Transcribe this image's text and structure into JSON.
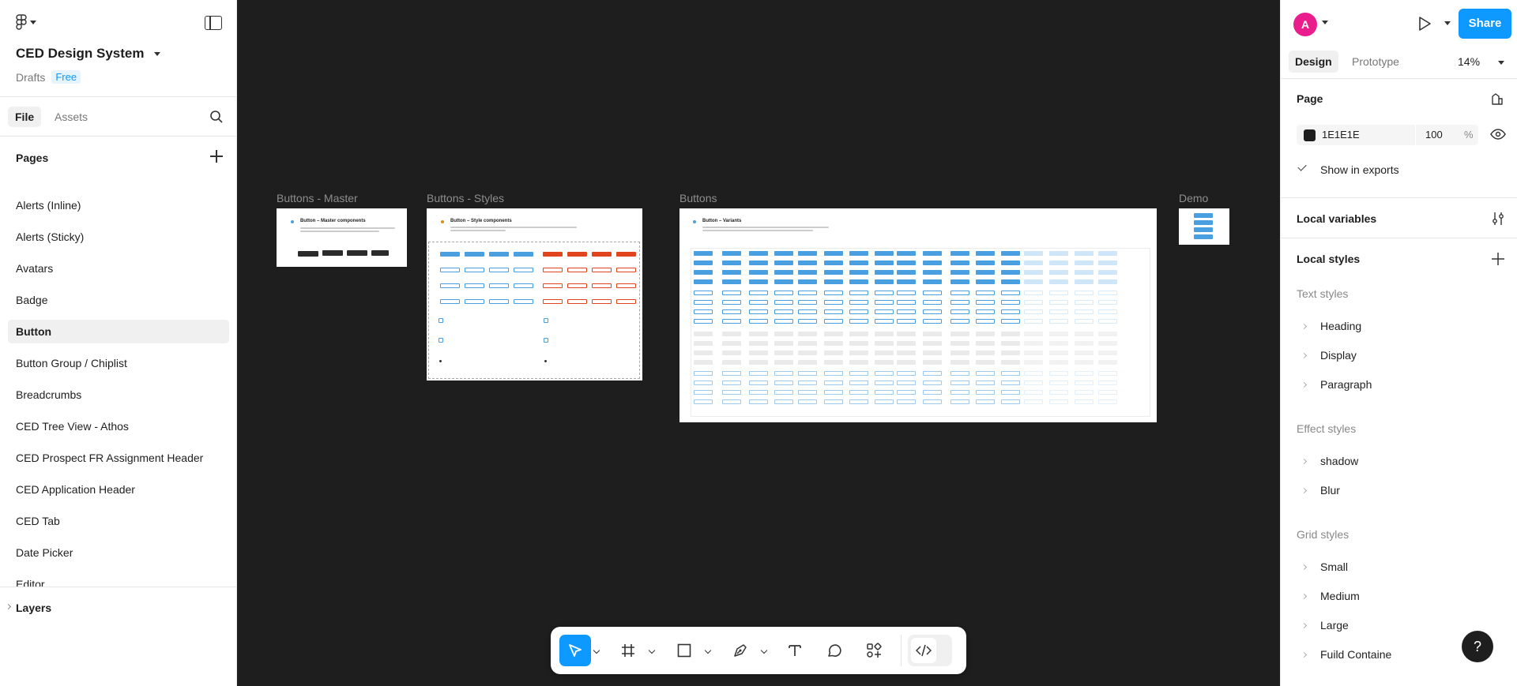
{
  "file": {
    "name": "CED Design System",
    "location": "Drafts",
    "plan": "Free"
  },
  "left_tabs": {
    "file": "File",
    "assets": "Assets"
  },
  "pages": {
    "header": "Pages",
    "items": [
      "Alerts (Inline)",
      "Alerts (Sticky)",
      "Avatars",
      "Badge",
      "Button",
      "Button Group / Chiplist",
      "Breadcrumbs",
      "CED Tree View - Athos",
      "CED Prospect FR Assignment Header",
      "CED Application Header",
      "CED Tab",
      "Date Picker",
      "Editor"
    ],
    "selected": "Button"
  },
  "layers": {
    "header": "Layers"
  },
  "canvas": {
    "background": "#1E1E1E",
    "frames": [
      {
        "label": "Buttons - Master",
        "title": "Button – Master components"
      },
      {
        "label": "Buttons - Styles",
        "title": "Button – Style components"
      },
      {
        "label": "Buttons",
        "title": "Button – Variants"
      },
      {
        "label": "Demo",
        "title": ""
      }
    ]
  },
  "toolbar": {
    "tools": [
      "move-tool",
      "frame-tool",
      "shape-tool",
      "pen-tool",
      "text-tool",
      "comment-tool",
      "actions-tool"
    ],
    "active": "move-tool"
  },
  "right": {
    "avatar_initial": "A",
    "share_label": "Share",
    "tabs": {
      "design": "Design",
      "prototype": "Prototype"
    },
    "zoom": "14%",
    "page": {
      "header": "Page",
      "fill_hex": "1E1E1E",
      "opacity": "100",
      "opacity_unit": "%",
      "show_in_exports": "Show in exports"
    },
    "local_variables": "Local variables",
    "local_styles": "Local styles",
    "text_styles": {
      "header": "Text styles",
      "items": [
        "Heading",
        "Display",
        "Paragraph"
      ]
    },
    "effect_styles": {
      "header": "Effect styles",
      "items": [
        "shadow",
        "Blur"
      ]
    },
    "grid_styles": {
      "header": "Grid styles",
      "items": [
        "Small",
        "Medium",
        "Large",
        "Fuild Containe"
      ]
    },
    "help": "?"
  },
  "colors": {
    "accent": "#0D99FF",
    "canvas": "#1E1E1E",
    "avatar": "#E91E8C",
    "button_blue": "#4A9FE0",
    "button_red": "#E0451F",
    "button_dark": "#2B2B2B"
  }
}
